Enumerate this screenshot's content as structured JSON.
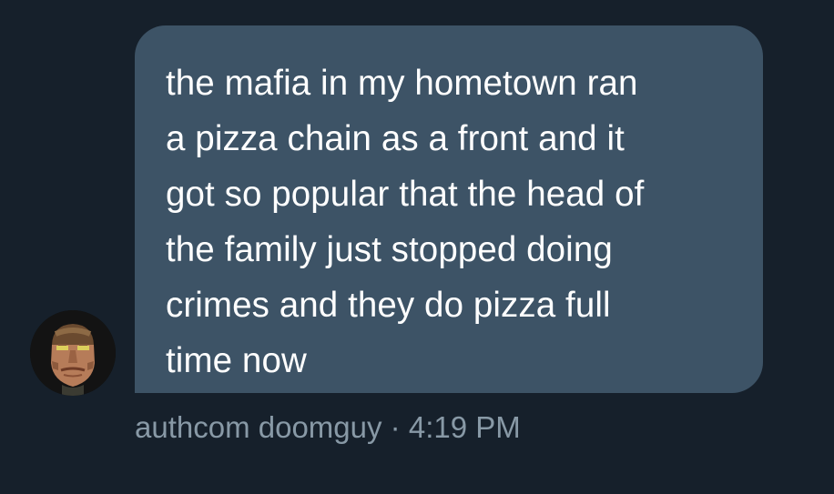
{
  "message": {
    "text": "the mafia in my hometown ran\na pizza chain as a front and it\ngot so popular that the head of\nthe family just stopped doing\ncrimes and they do pizza full\ntime now"
  },
  "sender": {
    "name": "authcom doomguy",
    "separator": "·",
    "time": "4:19 PM"
  },
  "colors": {
    "background": "#16202b",
    "bubble": "#3d5366",
    "message_text": "#ffffff",
    "meta_text": "#8899a6"
  }
}
